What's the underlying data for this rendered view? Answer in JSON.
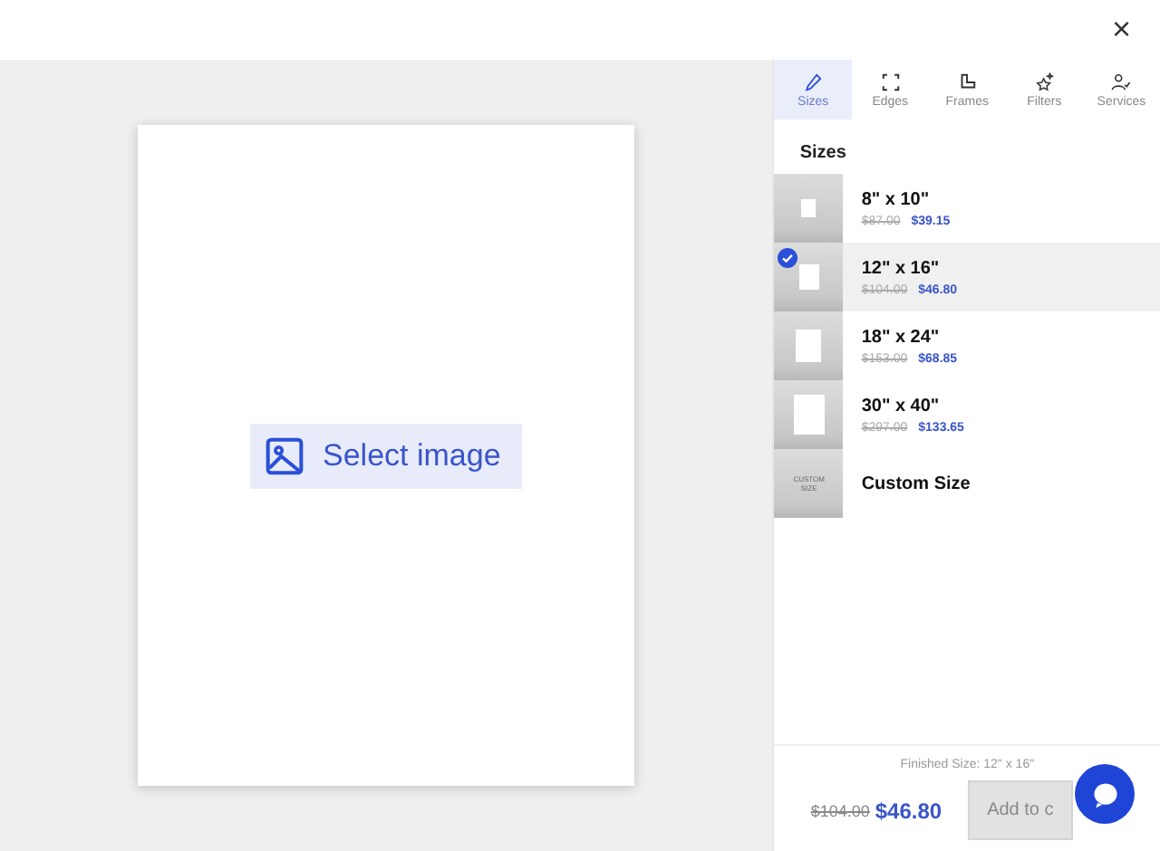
{
  "close_label": "×",
  "canvas": {
    "select_label": "Select image"
  },
  "tabs": [
    {
      "label": "Sizes",
      "kind": "pen",
      "selected": true
    },
    {
      "label": "Edges",
      "kind": "corners",
      "selected": false
    },
    {
      "label": "Frames",
      "kind": "frame",
      "selected": false
    },
    {
      "label": "Filters",
      "kind": "stars",
      "selected": false
    },
    {
      "label": "Services",
      "kind": "person",
      "selected": false
    }
  ],
  "section_title": "Sizes",
  "sizes": [
    {
      "name": "8\" x 10\"",
      "old_price": "$87.00",
      "price": "$39.15",
      "selected": false
    },
    {
      "name": "12\" x 16\"",
      "old_price": "$104.00",
      "price": "$46.80",
      "selected": true
    },
    {
      "name": "18\" x 24\"",
      "old_price": "$153.00",
      "price": "$68.85",
      "selected": false
    },
    {
      "name": "30\" x 40\"",
      "old_price": "$297.00",
      "price": "$133.65",
      "selected": false
    },
    {
      "name": "Custom Size",
      "thumb_label": "CUSTOM SIZE",
      "selected": false
    }
  ],
  "footer": {
    "finished": "Finished Size: 12\" x 16\"",
    "old_price": "$104.00",
    "price": "$46.80",
    "button": "Add to c"
  }
}
